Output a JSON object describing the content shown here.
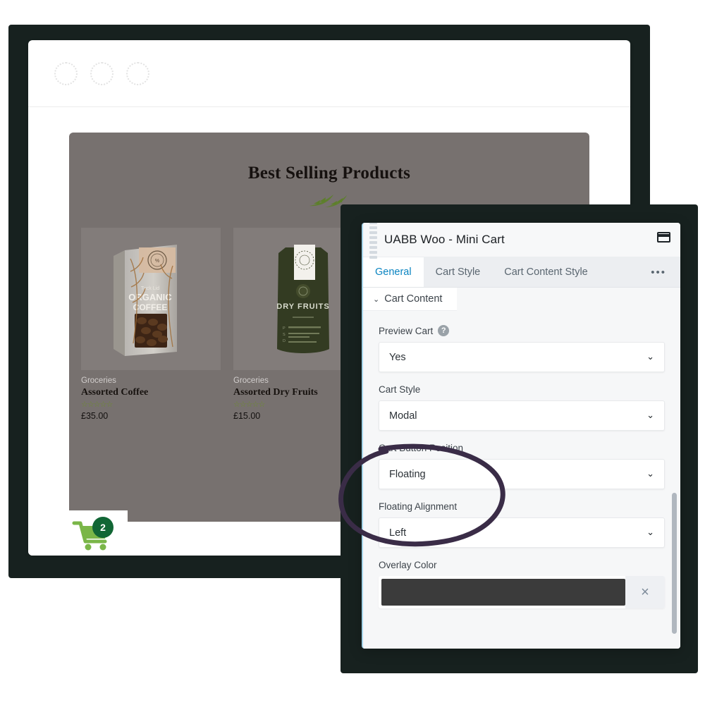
{
  "browser": {
    "dots": [
      "dot-1",
      "dot-2",
      "dot-3"
    ]
  },
  "store": {
    "section_title": "Best Selling Products",
    "divider_icon": "leaf-branch-icon",
    "products": [
      {
        "category": "Groceries",
        "name": "Assorted Coffee",
        "rating_stars": "☆☆☆☆☆",
        "price": "£35.00",
        "image_label": "ORGANIC COFFEE"
      },
      {
        "category": "Groceries",
        "name": "Assorted Dry Fruits",
        "rating_stars": "☆☆☆☆☆",
        "price": "£15.00",
        "image_label": "DRY FRUITS"
      }
    ],
    "cart": {
      "icon": "shopping-cart-icon",
      "count": "2",
      "icon_color": "#7ab648",
      "badge_color": "#116635"
    }
  },
  "panel": {
    "title": "UABB Woo - Mini Cart",
    "grip_icon": "drag-handle-icon",
    "window_icon": "panel-window-icon",
    "tabs": [
      {
        "label": "General",
        "active": true
      },
      {
        "label": "Cart Style",
        "active": false
      },
      {
        "label": "Cart Content Style",
        "active": false
      }
    ],
    "more_tabs_icon": "•••",
    "accordion": {
      "label": "Cart Content",
      "chevron": "⌄",
      "expanded": true
    },
    "fields": [
      {
        "label": "Preview Cart",
        "has_help": true,
        "help_glyph": "?",
        "type": "select",
        "value": "Yes",
        "chevron": "⌄"
      },
      {
        "label": "Cart Style",
        "has_help": false,
        "type": "select",
        "value": "Modal",
        "chevron": "⌄"
      },
      {
        "label": "Cart Button Position",
        "has_help": false,
        "type": "select",
        "value": "Floating",
        "chevron": "⌄"
      },
      {
        "label": "Floating Alignment",
        "has_help": false,
        "type": "select",
        "value": "Left",
        "chevron": "⌄"
      },
      {
        "label": "Overlay Color",
        "has_help": false,
        "type": "color",
        "value": "#3b3b3b",
        "clear_glyph": "×"
      }
    ],
    "accent_color": "#0a84c1"
  },
  "annotation": {
    "shape": "hand-drawn-ellipse",
    "color": "#3a2c47",
    "targets": "Cart Button Position / Floating"
  }
}
